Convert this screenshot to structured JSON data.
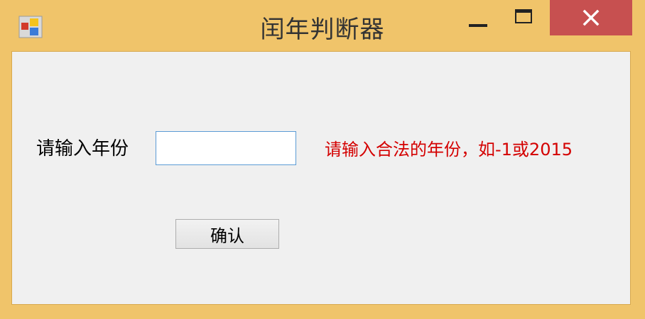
{
  "window": {
    "title": "闰年判断器"
  },
  "form": {
    "year_label": "请输入年份",
    "year_value": "",
    "hint": "请输入合法的年份，如-1或2015",
    "confirm_label": "确认"
  },
  "icons": {
    "app": "app-icon",
    "minimize": "minimize-icon",
    "maximize": "maximize-icon",
    "close": "close-icon"
  },
  "colors": {
    "frame": "#f0c46a",
    "close_button": "#c75050",
    "client_background": "#f0f0f0",
    "hint_text": "#d40000",
    "input_border": "#5b9bd5"
  }
}
